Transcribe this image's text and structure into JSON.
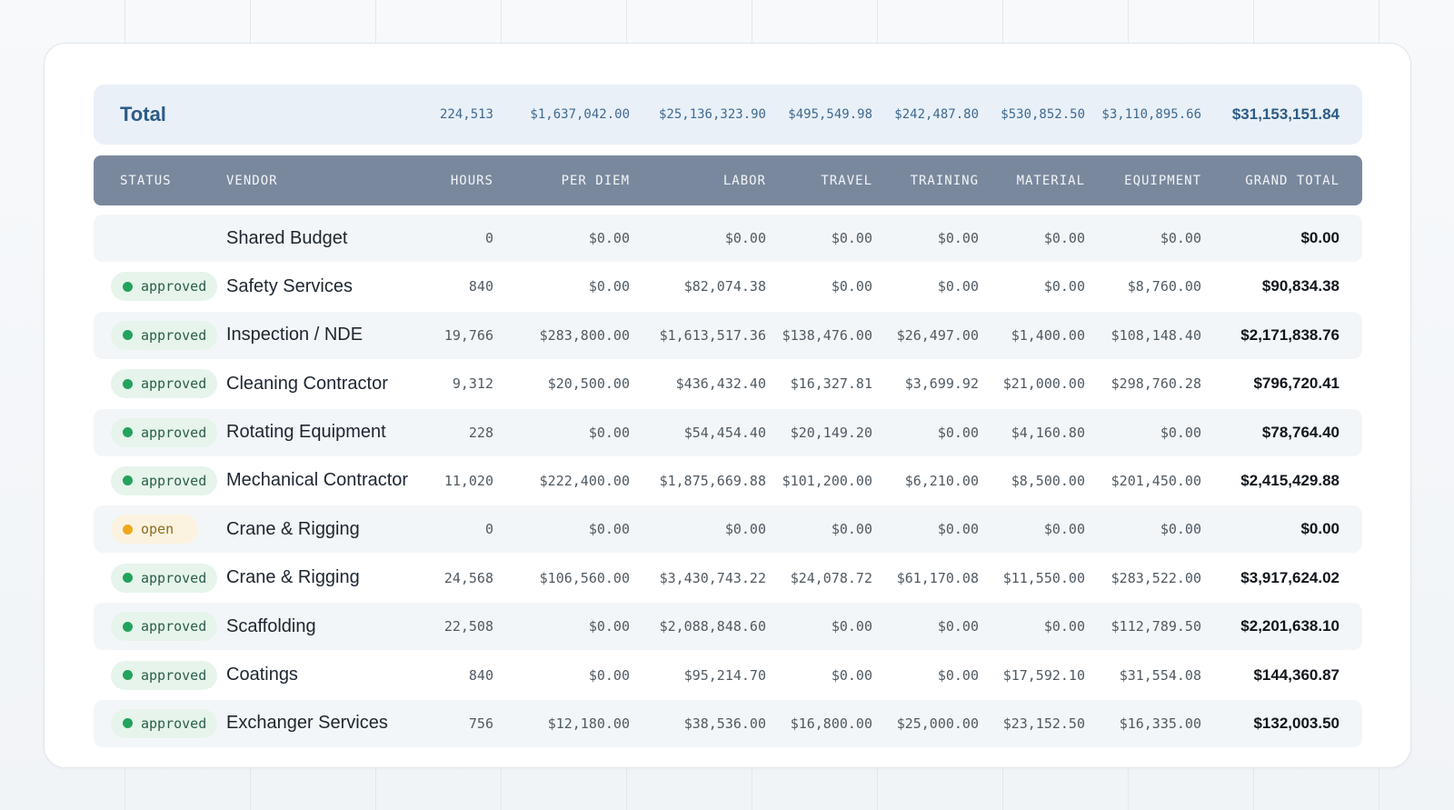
{
  "colors": {
    "header_bg": "#7a889d",
    "total_bg": "#e9f0f7",
    "approved_dot": "#23a35d",
    "open_dot": "#f0a81a",
    "accent": "#2d5b86"
  },
  "total": {
    "label": "Total",
    "hours": "224,513",
    "per_diem": "$1,637,042.00",
    "labor": "$25,136,323.90",
    "travel": "$495,549.98",
    "training": "$242,487.80",
    "material": "$530,852.50",
    "equipment": "$3,110,895.66",
    "grand_total": "$31,153,151.84"
  },
  "columns": {
    "status": "STATUS",
    "vendor": "VENDOR",
    "hours": "HOURS",
    "per_diem": "PER DIEM",
    "labor": "LABOR",
    "travel": "TRAVEL",
    "training": "TRAINING",
    "material": "MATERIAL",
    "equipment": "EQUIPMENT",
    "grand_total": "GRAND TOTAL"
  },
  "rows": [
    {
      "status": "",
      "vendor": "Shared Budget",
      "hours": "0",
      "per_diem": "$0.00",
      "labor": "$0.00",
      "travel": "$0.00",
      "training": "$0.00",
      "material": "$0.00",
      "equipment": "$0.00",
      "grand_total": "$0.00"
    },
    {
      "status": "approved",
      "vendor": "Safety Services",
      "hours": "840",
      "per_diem": "$0.00",
      "labor": "$82,074.38",
      "travel": "$0.00",
      "training": "$0.00",
      "material": "$0.00",
      "equipment": "$8,760.00",
      "grand_total": "$90,834.38"
    },
    {
      "status": "approved",
      "vendor": "Inspection / NDE",
      "hours": "19,766",
      "per_diem": "$283,800.00",
      "labor": "$1,613,517.36",
      "travel": "$138,476.00",
      "training": "$26,497.00",
      "material": "$1,400.00",
      "equipment": "$108,148.40",
      "grand_total": "$2,171,838.76"
    },
    {
      "status": "approved",
      "vendor": "Cleaning Contractor",
      "hours": "9,312",
      "per_diem": "$20,500.00",
      "labor": "$436,432.40",
      "travel": "$16,327.81",
      "training": "$3,699.92",
      "material": "$21,000.00",
      "equipment": "$298,760.28",
      "grand_total": "$796,720.41"
    },
    {
      "status": "approved",
      "vendor": "Rotating Equipment",
      "hours": "228",
      "per_diem": "$0.00",
      "labor": "$54,454.40",
      "travel": "$20,149.20",
      "training": "$0.00",
      "material": "$4,160.80",
      "equipment": "$0.00",
      "grand_total": "$78,764.40"
    },
    {
      "status": "approved",
      "vendor": "Mechanical Contractor",
      "hours": "11,020",
      "per_diem": "$222,400.00",
      "labor": "$1,875,669.88",
      "travel": "$101,200.00",
      "training": "$6,210.00",
      "material": "$8,500.00",
      "equipment": "$201,450.00",
      "grand_total": "$2,415,429.88"
    },
    {
      "status": "open",
      "vendor": "Crane & Rigging",
      "hours": "0",
      "per_diem": "$0.00",
      "labor": "$0.00",
      "travel": "$0.00",
      "training": "$0.00",
      "material": "$0.00",
      "equipment": "$0.00",
      "grand_total": "$0.00"
    },
    {
      "status": "approved",
      "vendor": "Crane & Rigging",
      "hours": "24,568",
      "per_diem": "$106,560.00",
      "labor": "$3,430,743.22",
      "travel": "$24,078.72",
      "training": "$61,170.08",
      "material": "$11,550.00",
      "equipment": "$283,522.00",
      "grand_total": "$3,917,624.02"
    },
    {
      "status": "approved",
      "vendor": "Scaffolding",
      "hours": "22,508",
      "per_diem": "$0.00",
      "labor": "$2,088,848.60",
      "travel": "$0.00",
      "training": "$0.00",
      "material": "$0.00",
      "equipment": "$112,789.50",
      "grand_total": "$2,201,638.10"
    },
    {
      "status": "approved",
      "vendor": "Coatings",
      "hours": "840",
      "per_diem": "$0.00",
      "labor": "$95,214.70",
      "travel": "$0.00",
      "training": "$0.00",
      "material": "$17,592.10",
      "equipment": "$31,554.08",
      "grand_total": "$144,360.87"
    },
    {
      "status": "approved",
      "vendor": "Exchanger Services",
      "hours": "756",
      "per_diem": "$12,180.00",
      "labor": "$38,536.00",
      "travel": "$16,800.00",
      "training": "$25,000.00",
      "material": "$23,152.50",
      "equipment": "$16,335.00",
      "grand_total": "$132,003.50"
    }
  ]
}
